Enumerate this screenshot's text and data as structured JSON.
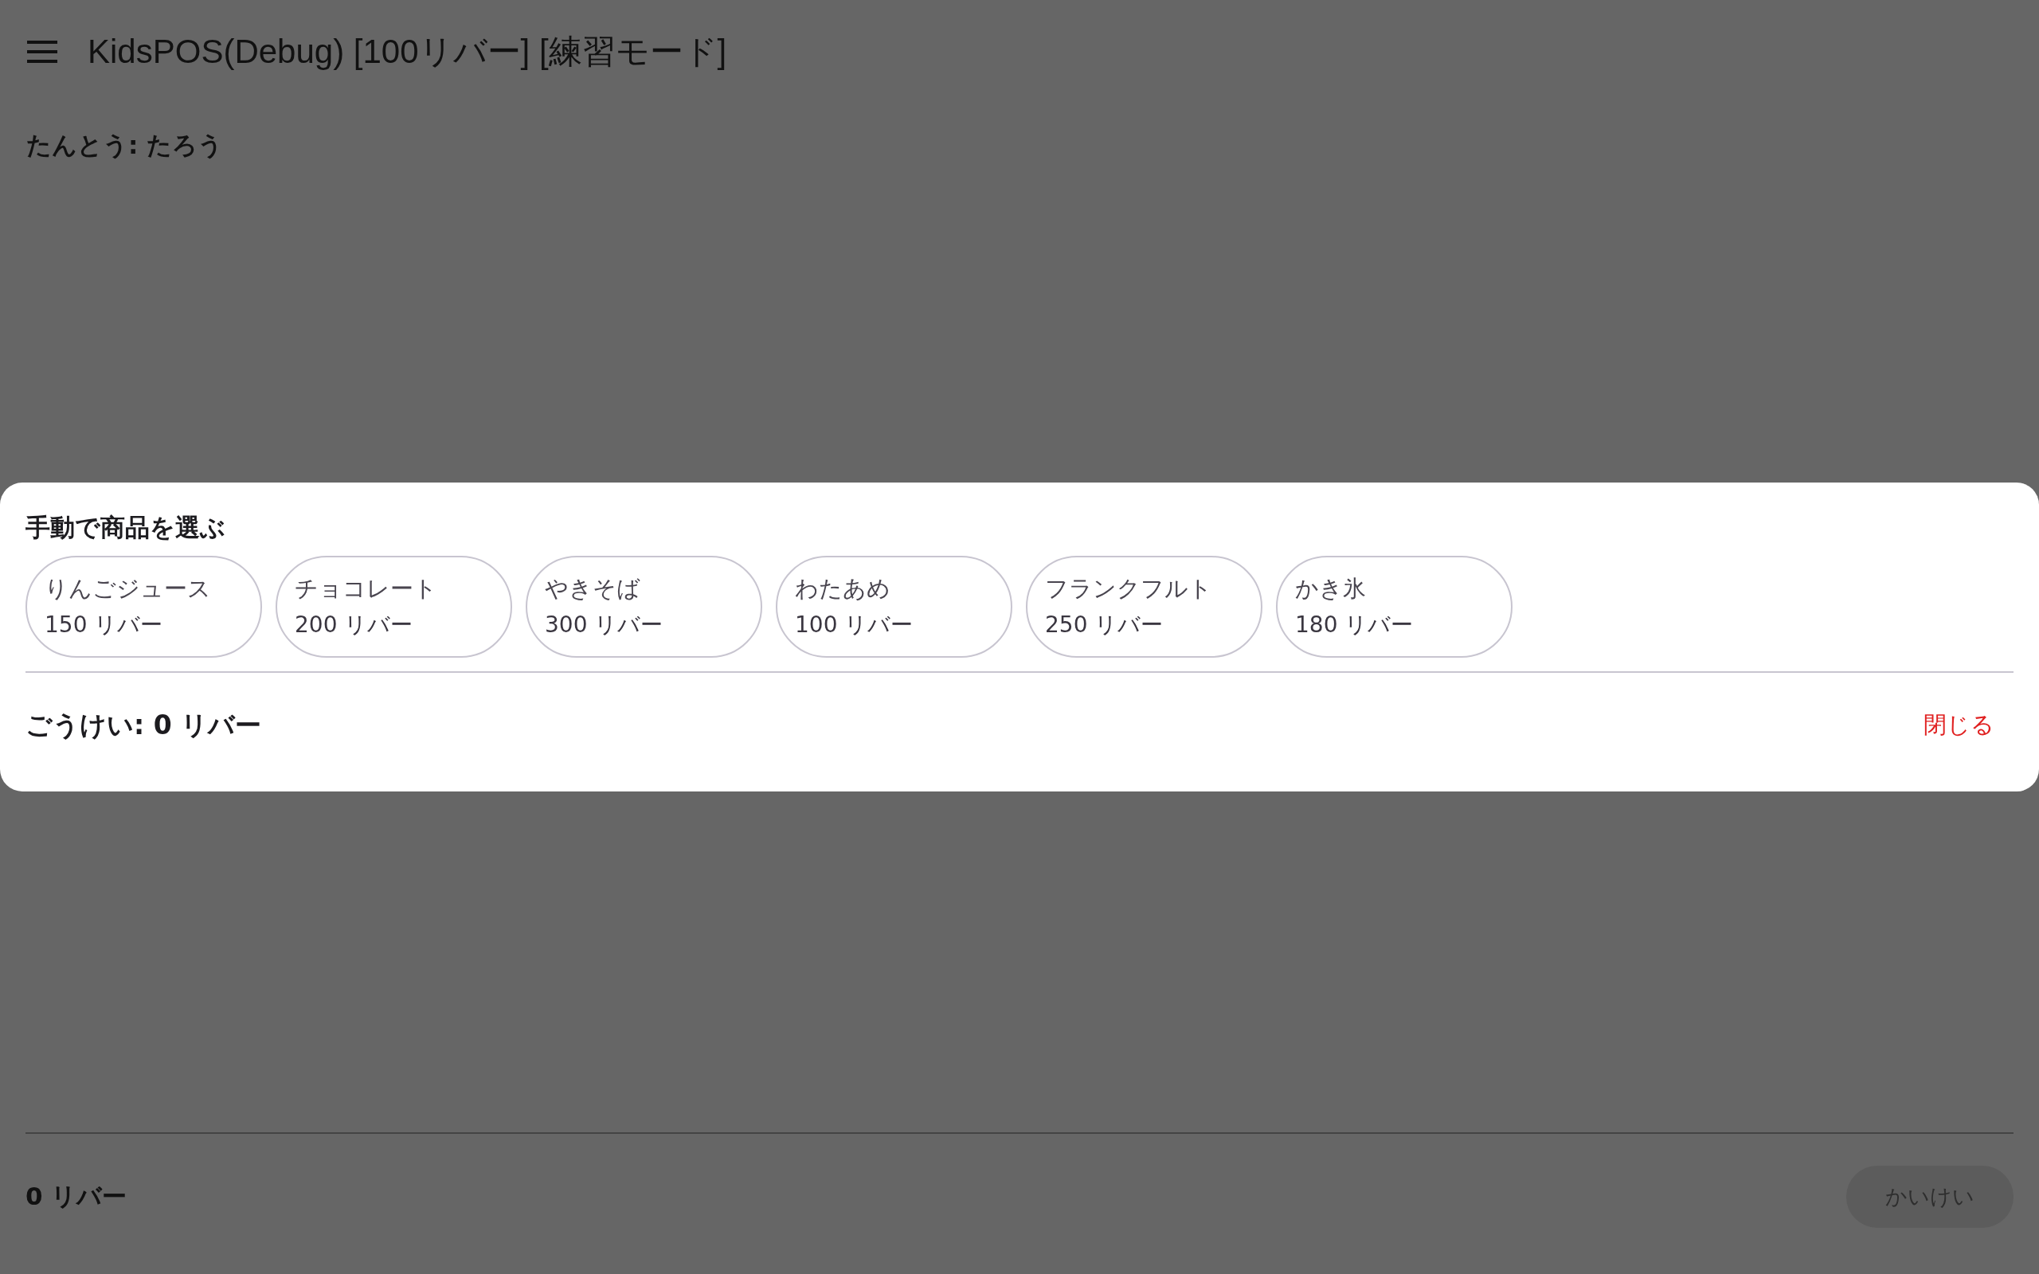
{
  "app_bar": {
    "title": "KidsPOS(Debug) [100リバー] [練習モード]"
  },
  "staff": "たんとう: たろう",
  "dialog": {
    "title": "手動で商品を選ぶ",
    "items": [
      {
        "name": "りんごジュース",
        "price": "150 リバー"
      },
      {
        "name": "チョコレート",
        "price": "200 リバー"
      },
      {
        "name": "やきそば",
        "price": "300 リバー"
      },
      {
        "name": "わたあめ",
        "price": "100 リバー"
      },
      {
        "name": "フランクフルト",
        "price": "250 リバー"
      },
      {
        "name": "かき氷",
        "price": "180 リバー"
      }
    ],
    "total": "ごうけい: 0 リバー",
    "close": "閉じる"
  },
  "footer": {
    "total": "0 リバー",
    "checkout": {
      "label": "かいけい",
      "disabled": true
    }
  }
}
